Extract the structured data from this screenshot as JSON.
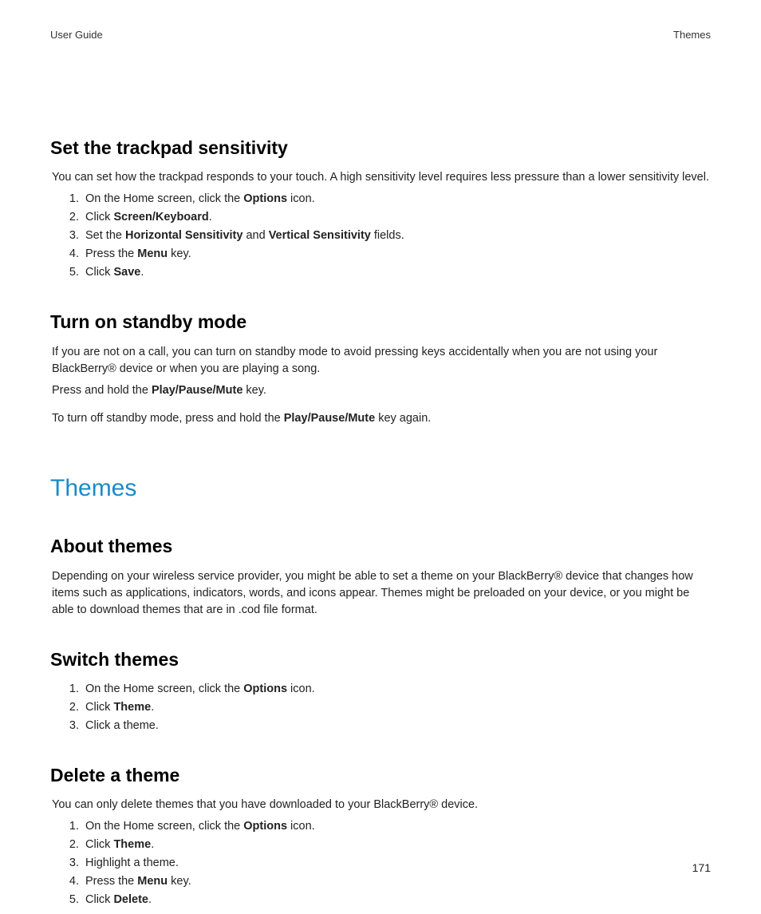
{
  "header": {
    "left": "User Guide",
    "right": "Themes"
  },
  "page_number": "171",
  "section_title": "Themes",
  "s1": {
    "heading": "Set the trackpad sensitivity",
    "intro": "You can set how the trackpad responds to your touch. A high sensitivity level requires less pressure than a lower sensitivity level.",
    "steps": {
      "a1": "On the Home screen, click the ",
      "a2": "Options",
      "a3": " icon.",
      "b1": "Click ",
      "b2": "Screen/Keyboard",
      "b3": ".",
      "c1": "Set the ",
      "c2": "Horizontal Sensitivity",
      "c3": " and ",
      "c4": "Vertical Sensitivity",
      "c5": " fields.",
      "d1": "Press the ",
      "d2": "Menu",
      "d3": " key.",
      "e1": "Click ",
      "e2": "Save",
      "e3": "."
    }
  },
  "s2": {
    "heading": "Turn on standby mode",
    "intro": "If you are not on a call, you can turn on standby mode to avoid pressing keys accidentally when you are not using your BlackBerry® device or when you are playing a song.",
    "p2a": "Press and hold the ",
    "p2b": "Play/Pause/Mute",
    "p2c": " key.",
    "p3a": "To turn off standby mode, press and hold the ",
    "p3b": "Play/Pause/Mute",
    "p3c": " key again."
  },
  "s3": {
    "heading": "About themes",
    "intro": "Depending on your wireless service provider, you might be able to set a theme on your BlackBerry® device that changes how items such as applications, indicators, words, and icons appear. Themes might be preloaded on your device, or you might be able to download themes that are in .cod file format."
  },
  "s4": {
    "heading": "Switch themes",
    "steps": {
      "a1": "On the Home screen, click the ",
      "a2": "Options",
      "a3": " icon.",
      "b1": "Click ",
      "b2": "Theme",
      "b3": ".",
      "c1": "Click a theme."
    }
  },
  "s5": {
    "heading": "Delete a theme",
    "intro": "You can only delete themes that you have downloaded to your BlackBerry® device.",
    "steps": {
      "a1": "On the Home screen, click the ",
      "a2": "Options",
      "a3": " icon.",
      "b1": "Click ",
      "b2": "Theme",
      "b3": ".",
      "c1": "Highlight a theme.",
      "d1": "Press the ",
      "d2": "Menu",
      "d3": " key.",
      "e1": "Click ",
      "e2": "Delete",
      "e3": "."
    }
  }
}
